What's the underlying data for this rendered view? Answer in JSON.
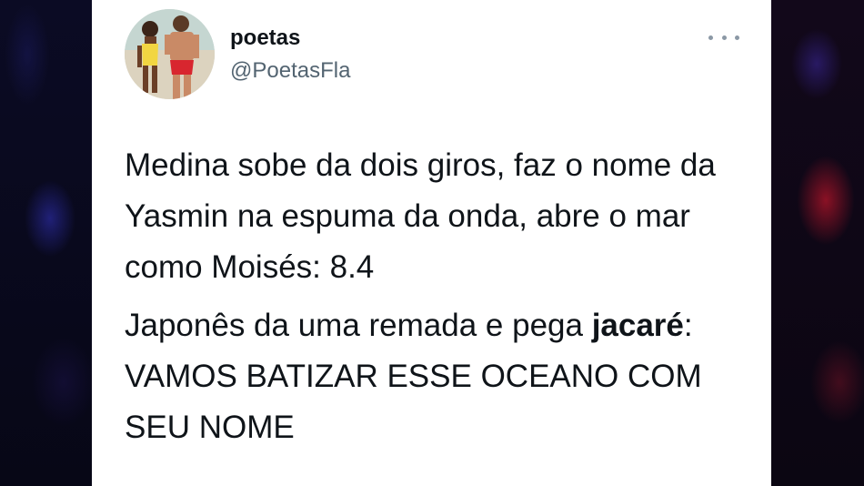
{
  "tweet": {
    "author": {
      "display_name": "poetas",
      "handle": "@PoetasFla"
    },
    "more_icon": "more-horizontal-icon",
    "paragraph_1": "Medina sobe da dois giros, faz o nome da Yasmin na espuma da onda, abre o mar como Moisés: 8.4",
    "paragraph_2_lead": "Japonês da uma remada e pega ",
    "paragraph_2_bold": "jacaré",
    "paragraph_2_rest": ": VAMOS BATIZAR ESSE OCEANO COM SEU NOME"
  },
  "colors": {
    "card_background": "#ffffff",
    "text_primary": "#0f1419",
    "text_secondary": "#536471",
    "backdrop": "#05050c"
  }
}
